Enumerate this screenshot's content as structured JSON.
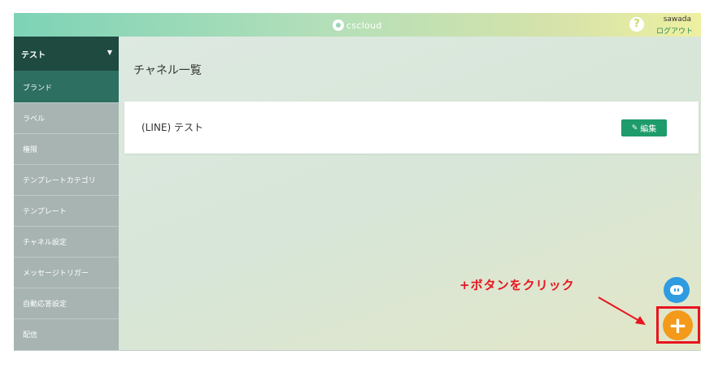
{
  "header": {
    "logo_text": "cscloud",
    "help_label": "?",
    "user_name": "sawada",
    "logout_label": "ログアウト"
  },
  "sidebar": {
    "selector_label": "テスト",
    "items": [
      {
        "label": "ブランド",
        "active": true
      },
      {
        "label": "ラベル"
      },
      {
        "label": "権限"
      },
      {
        "label": "テンプレートカテゴリ"
      },
      {
        "label": "テンプレート"
      },
      {
        "label": "チャネル設定"
      },
      {
        "label": "メッセージトリガー"
      },
      {
        "label": "自動応答設定"
      },
      {
        "label": "配信"
      }
    ]
  },
  "main": {
    "page_title": "チャネル一覧",
    "channels": [
      {
        "name": "(LINE) テスト",
        "edit_label": "編集"
      }
    ]
  },
  "annotation": {
    "text": "+ボタンをクリック"
  },
  "fab": {
    "add_label": "+"
  },
  "colors": {
    "accent": "#1e9b6a",
    "sidebar_header": "#1e4a40",
    "sidebar_active": "#2d6f60",
    "fab_add": "#f39a1b",
    "fab_chat": "#2f9be0",
    "annotation": "#e8141f"
  },
  "icons": [
    "logo-icon",
    "help-icon",
    "caret-down-icon",
    "pencil-icon",
    "chat-icon",
    "plus-icon",
    "arrow-icon"
  ]
}
